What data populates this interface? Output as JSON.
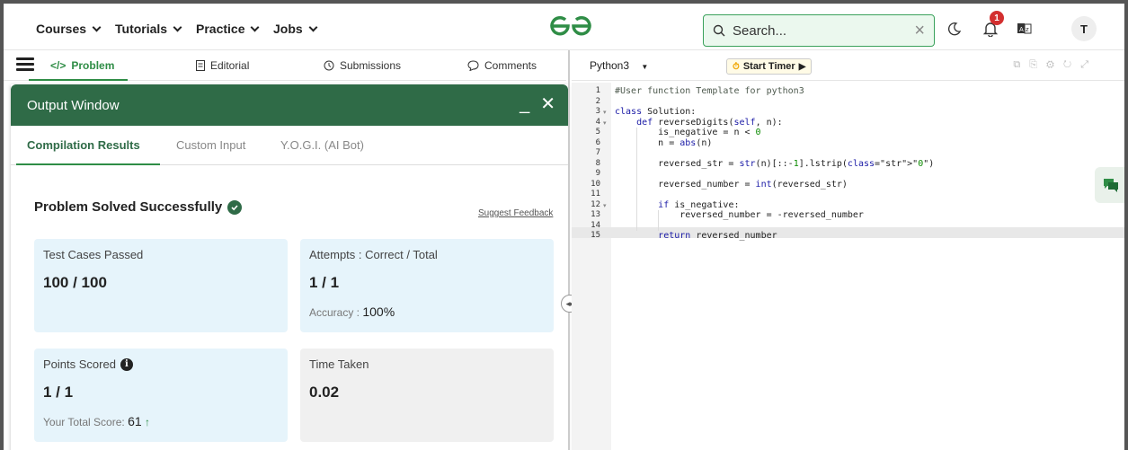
{
  "nav": {
    "courses": "Courses",
    "tutorials": "Tutorials",
    "practice": "Practice",
    "jobs": "Jobs",
    "search_placeholder": "Search...",
    "notification_count": "1",
    "avatar_initial": "T"
  },
  "left_tabs": {
    "problem": "Problem",
    "editorial": "Editorial",
    "submissions": "Submissions",
    "comments": "Comments"
  },
  "output": {
    "title": "Output Window",
    "tabs": [
      "Compilation Results",
      "Custom Input",
      "Y.O.G.I. (AI Bot)"
    ],
    "status": "Problem Solved Successfully",
    "suggest": "Suggest Feedback",
    "cards": {
      "tests_title": "Test Cases Passed",
      "tests_value": "100 / 100",
      "attempts_title": "Attempts : Correct / Total",
      "attempts_value": "1 / 1",
      "accuracy_label": "Accuracy :",
      "accuracy_value": "100%",
      "points_title": "Points Scored",
      "points_value": "1 / 1",
      "total_label": "Your Total Score:",
      "total_value": "61",
      "time_title": "Time Taken",
      "time_value": "0.02"
    }
  },
  "editor": {
    "language": "Python3",
    "timer_label": "Start Timer",
    "lines": [
      "#User function Template for python3",
      "",
      "class Solution:",
      "    def reverseDigits(self, n):",
      "        is_negative = n < 0",
      "        n = abs(n)",
      "",
      "        reversed_str = str(n)[::-1].lstrip(\"0\")",
      "",
      "        reversed_number = int(reversed_str)",
      "",
      "        if is_negative:",
      "            reversed_number = -reversed_number",
      "",
      "        return reversed_number"
    ],
    "line_numbers": [
      "1",
      "2",
      "3",
      "4",
      "5",
      "6",
      "7",
      "8",
      "9",
      "10",
      "11",
      "12",
      "13",
      "14",
      "15"
    ]
  },
  "colors": {
    "brand_green": "#2f8d46",
    "header_green": "#2f6b47",
    "card_blue": "#e6f4fb",
    "card_gray": "#f0f0f0"
  }
}
